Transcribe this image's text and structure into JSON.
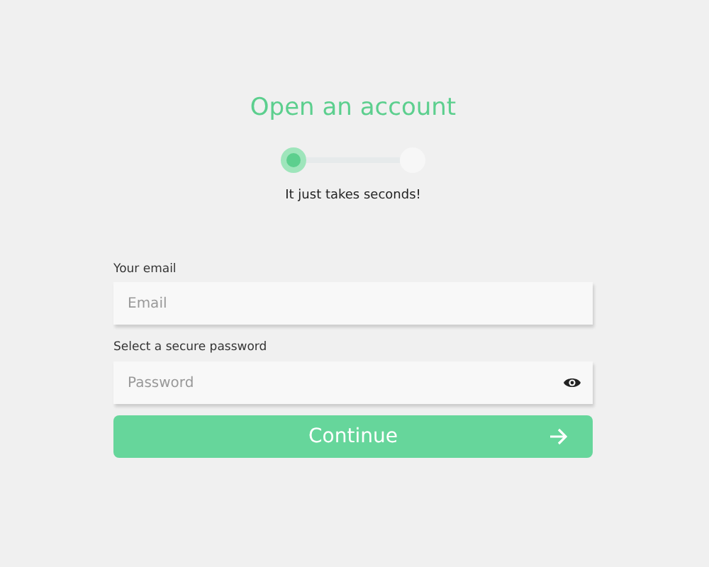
{
  "title": "Open an account",
  "steps": [
    {
      "selected": true
    },
    {
      "selected": false
    }
  ],
  "subtitle": "It just takes seconds!",
  "fields": [
    {
      "kind": "text",
      "label": "Your email",
      "placeholder": "Email"
    },
    {
      "kind": "password",
      "label": "Select a secure password",
      "placeholder": "Password"
    }
  ],
  "button": {
    "label": "Continue"
  }
}
